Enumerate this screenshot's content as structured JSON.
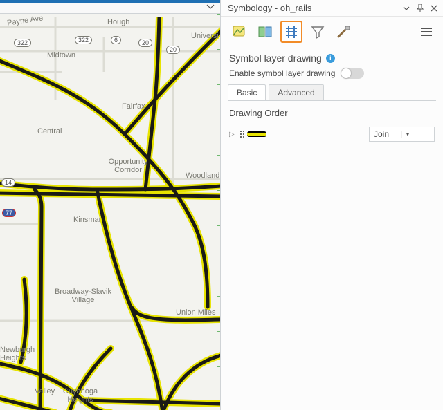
{
  "panel": {
    "title": "Symbology - oh_rails",
    "section_title": "Symbol layer drawing",
    "enable_label": "Enable symbol layer drawing",
    "tabs": {
      "basic": "Basic",
      "advanced": "Advanced"
    },
    "drawing_order_label": "Drawing Order",
    "join_label": "Join"
  },
  "map": {
    "labels": {
      "payne": "Payne Ave",
      "hough": "Hough",
      "universi": "Universi",
      "midtown": "Midtown",
      "fairfax": "Fairfax",
      "central": "Central",
      "opportunity": "Opportunity Corridor",
      "woodland": "Woodland",
      "kinsman": "Kinsman",
      "broadway": "Broadway-Slavik Village",
      "union": "Union Miles",
      "newburgh": "Newburgh Heights",
      "valley": "Valley",
      "cuyahoga": "Cuyahoga Heights"
    },
    "shields": {
      "i77": "77",
      "us322a": "322",
      "us322b": "322",
      "us6": "6",
      "us20a": "20",
      "us20b": "20",
      "sr14": "14"
    }
  }
}
